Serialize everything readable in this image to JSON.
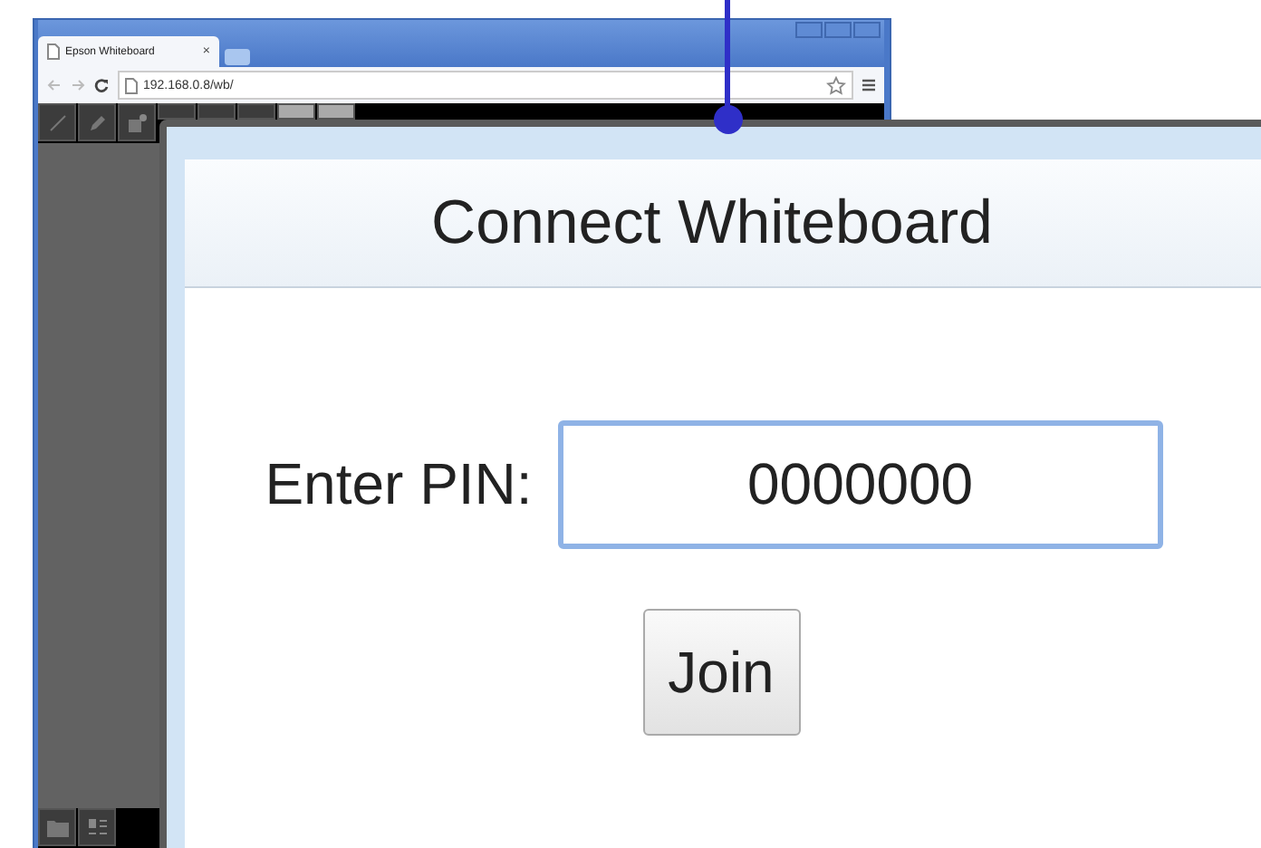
{
  "browser": {
    "tab_title": "Epson Whiteboard",
    "tab_close": "×",
    "url": "192.168.0.8/wb/"
  },
  "dialog": {
    "title": "Connect Whiteboard",
    "pin_label": "Enter PIN:",
    "pin_value": "0000000",
    "join_button": "Join"
  }
}
